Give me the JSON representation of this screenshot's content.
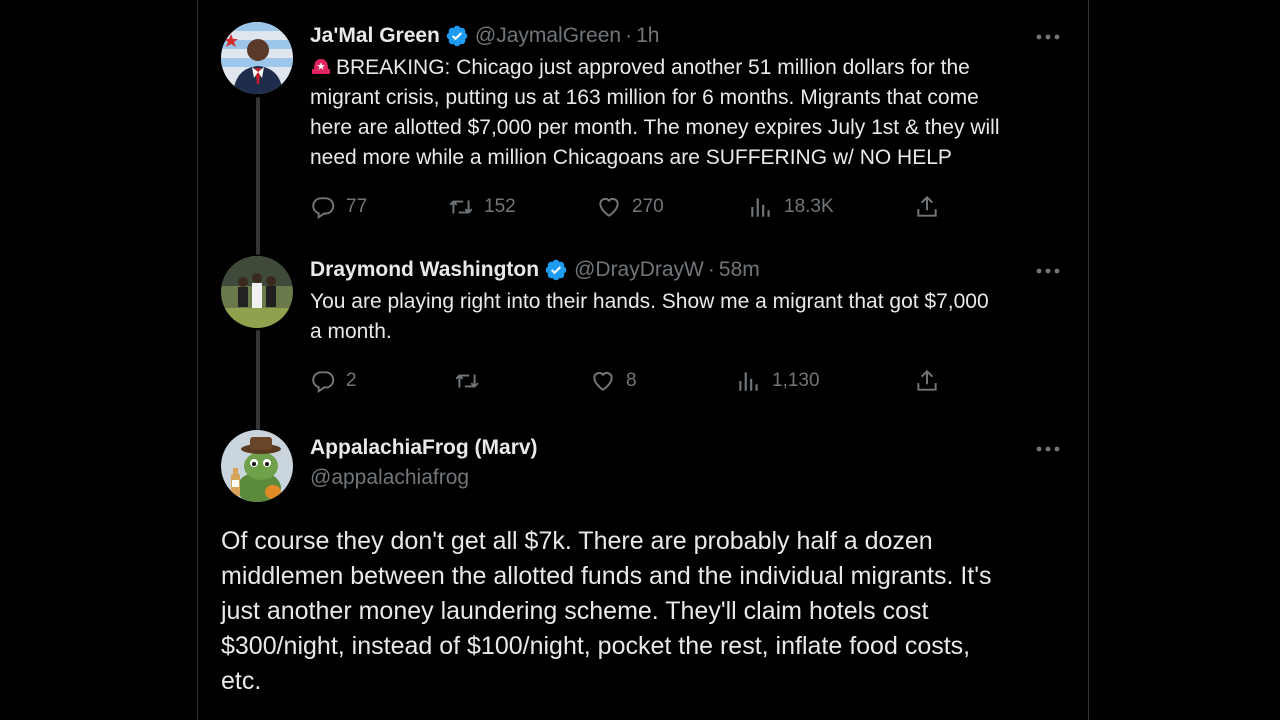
{
  "tweets": [
    {
      "name": "Ja'Mal Green",
      "handle": "@JaymalGreen",
      "separator": "·",
      "time": "1h",
      "text_lines": [
        "BREAKING: Chicago just approved another 51 million dollars for the",
        "migrant crisis, putting us at 163 million for 6 months. Migrants that come",
        "here are allotted $7,000 per month. The money expires July 1st & they will",
        "need more while a million Chicagoans are SUFFERING w/ NO HELP"
      ],
      "replies": "77",
      "retweets": "152",
      "likes": "270",
      "views": "18.3K",
      "verified": true
    },
    {
      "name": "Draymond Washington",
      "handle": "@DrayDrayW",
      "separator": "·",
      "time": "58m",
      "text_lines": [
        "You are playing right into their hands. Show me a migrant that got $7,000",
        "a month."
      ],
      "replies": "2",
      "retweets": "",
      "likes": "8",
      "views": "1,130",
      "verified": true
    },
    {
      "name": "AppalachiaFrog (Marv)",
      "handle": "@appalachiafrog",
      "text_lines": [
        "Of course they don't get all $7k. There are probably half a dozen",
        "middlemen between the allotted funds and the individual migrants. It's",
        "just another money laundering scheme. They'll claim hotels cost",
        "$300/night, instead of $100/night, pocket the rest, inflate food costs,",
        "etc."
      ],
      "verified": false
    }
  ],
  "icons": {
    "more": "more-horizontal-icon",
    "reply": "reply-icon",
    "retweet": "retweet-icon",
    "like": "like-icon",
    "views": "views-icon",
    "share": "share-icon",
    "verified": "verified-badge-icon",
    "siren": "siren-emoji-icon"
  },
  "colors": {
    "background": "#000000",
    "text": "#e7e9ea",
    "muted": "#71767b",
    "verified": "#1d9bf0",
    "thread_line": "#333639"
  }
}
